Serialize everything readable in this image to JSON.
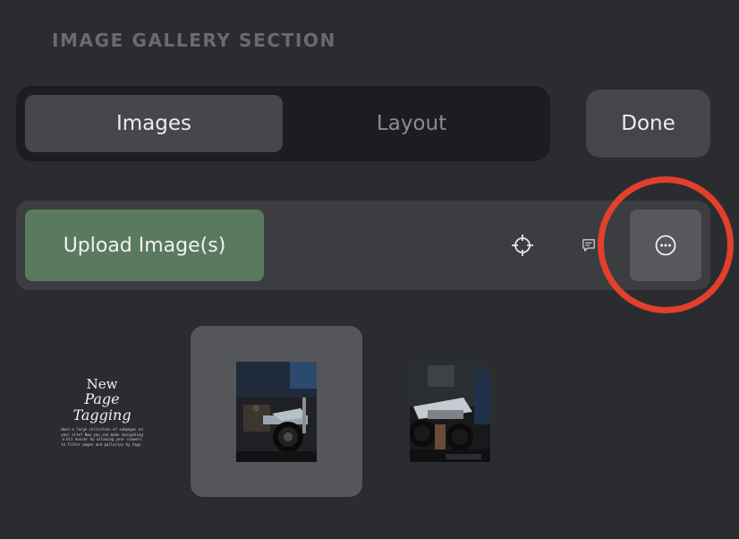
{
  "section": {
    "title": "IMAGE GALLERY SECTION"
  },
  "tabs": [
    {
      "label": "Images",
      "active": true
    },
    {
      "label": "Layout",
      "active": false
    }
  ],
  "done_label": "Done",
  "toolbar": {
    "upload_label": "Upload Image(s)",
    "icons": [
      "crosshair-icon",
      "comment-icon",
      "more-options-icon"
    ]
  },
  "gallery": {
    "items": [
      {
        "kind": "text-card",
        "title_line1": "New",
        "title_line2": "Page Tagging",
        "body": "Have a large collection of subpages on your site? Now you can make navigating a bit easier by allowing your viewers to filter pages and galleries by tags."
      },
      {
        "kind": "photo",
        "subject": "motorcycle",
        "selected": true
      },
      {
        "kind": "photo",
        "subject": "motorcycle",
        "selected": false
      }
    ]
  },
  "colors": {
    "background": "#2b2c30",
    "upload_green": "#5a7a60",
    "highlight_red": "#e2402b"
  }
}
